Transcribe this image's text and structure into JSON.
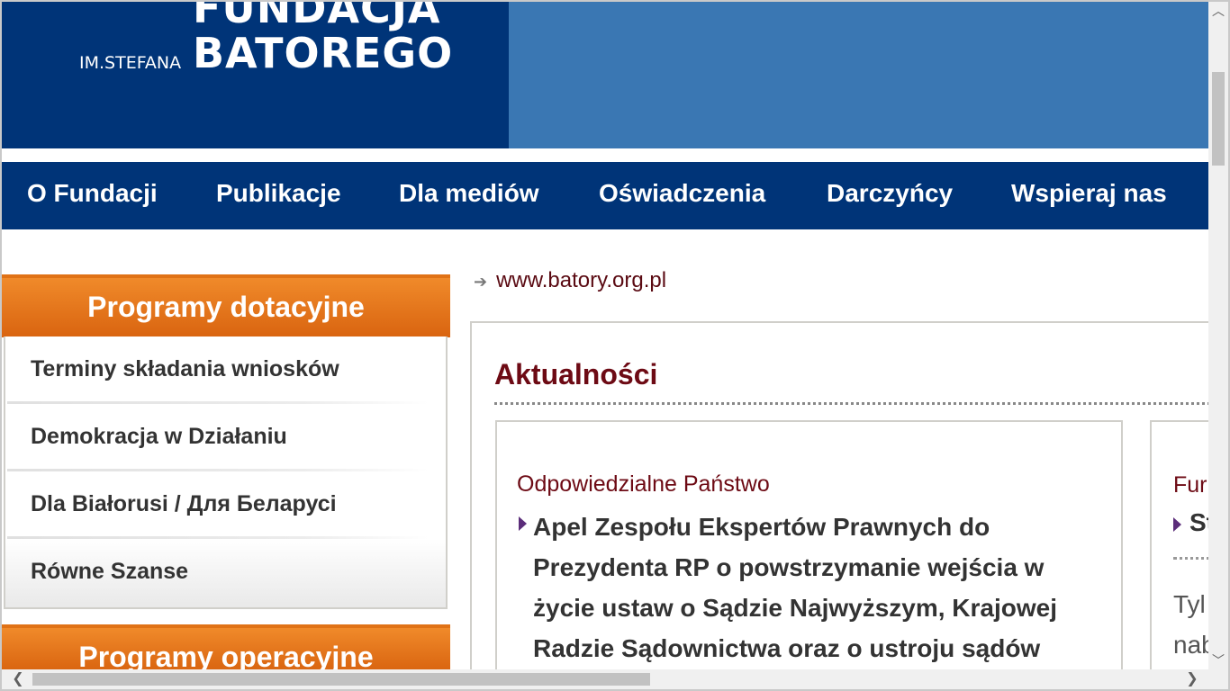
{
  "header": {
    "logo_top": "FUNDACJA",
    "logo_small": "IM.STEFANA",
    "logo_main": "BATOREGO"
  },
  "nav": {
    "items": [
      "O Fundacji",
      "Publikacje",
      "Dla mediów",
      "Oświadczenia",
      "Darczyńcy",
      "Wspieraj nas"
    ]
  },
  "sidebar": {
    "section1_title": "Programy dotacyjne",
    "items": [
      "Terminy składania wniosków",
      "Demokracja w Działaniu",
      "Dla Białorusi / Для Беларусі",
      "Równe Szanse"
    ],
    "section2_title": "Programy operacyjne"
  },
  "main": {
    "link": "www.batory.org.pl",
    "news_title": "Aktualności",
    "card1": {
      "category": "Odpowiedzialne Państwo",
      "title_lines": [
        "Apel Zespołu Ekspertów Prawnych do",
        "Prezydenta RP o powstrzymanie wejścia w",
        "życie ustaw o Sądzie Najwyższym, Krajowej",
        "Radzie Sądownictwa oraz o ustroju sądów"
      ]
    },
    "card2": {
      "category": "Fur",
      "title": "St",
      "text_lines": [
        "Tyl",
        "nab"
      ]
    }
  },
  "colors": {
    "header_dark": "#003478",
    "header_light": "#3a77b3",
    "accent_orange": "#e07216",
    "maroon": "#6d0a14"
  }
}
